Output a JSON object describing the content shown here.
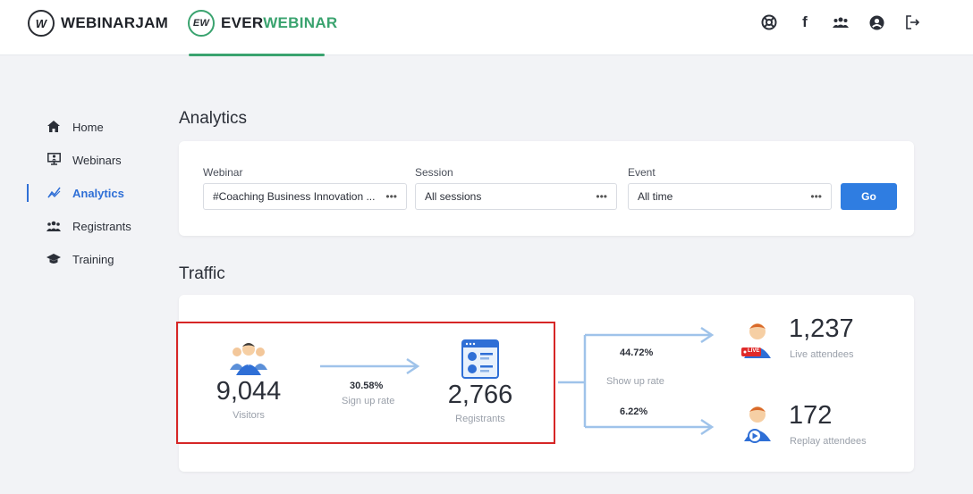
{
  "brands": {
    "webinarjam": {
      "logo": "W",
      "name": "WEBINARJAM"
    },
    "everwebinar": {
      "logo": "EW",
      "name_part1": "EVER",
      "name_part2": "WEBINAR"
    }
  },
  "top_icons": [
    "support-icon",
    "facebook-icon",
    "community-icon",
    "account-icon",
    "logout-icon"
  ],
  "sidebar": {
    "items": [
      {
        "label": "Home",
        "icon": "home-icon",
        "active": false
      },
      {
        "label": "Webinars",
        "icon": "webinars-icon",
        "active": false
      },
      {
        "label": "Analytics",
        "icon": "analytics-icon",
        "active": true
      },
      {
        "label": "Registrants",
        "icon": "registrants-icon",
        "active": false
      },
      {
        "label": "Training",
        "icon": "training-icon",
        "active": false
      }
    ]
  },
  "analytics": {
    "title": "Analytics",
    "filters": {
      "webinar_label": "Webinar",
      "webinar_value": "#Coaching Business Innovation ...",
      "session_label": "Session",
      "session_value": "All sessions",
      "event_label": "Event",
      "event_value": "All time",
      "more": "•••",
      "go": "Go"
    }
  },
  "traffic": {
    "title": "Traffic",
    "visitors": {
      "value": "9,044",
      "label": "Visitors"
    },
    "signup": {
      "rate": "30.58%",
      "label": "Sign up rate"
    },
    "registrants": {
      "value": "2,766",
      "label": "Registrants"
    },
    "showup": {
      "live_rate": "44.72%",
      "label": "Show up rate",
      "replay_rate": "6.22%"
    },
    "live": {
      "value": "1,237",
      "label": "Live attendees",
      "badge": "LIVE"
    },
    "replay": {
      "value": "172",
      "label": "Replay attendees"
    }
  },
  "colors": {
    "accent": "#2f7de1",
    "brand_green": "#3aa36f",
    "highlight": "#d62626",
    "arrow": "#9fc3ea"
  }
}
